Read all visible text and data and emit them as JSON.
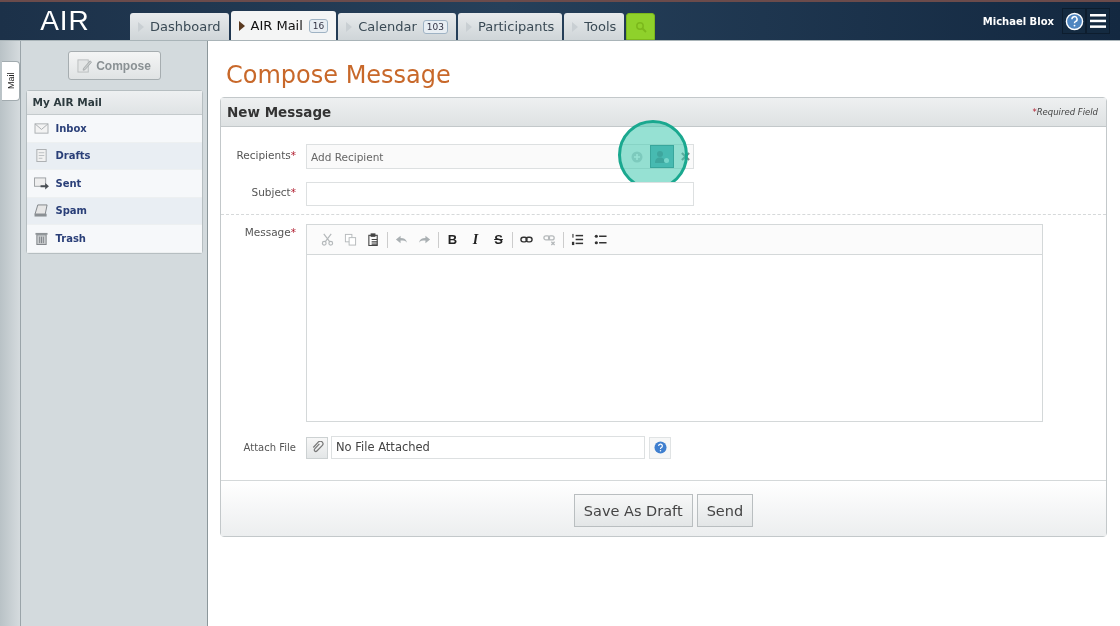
{
  "header": {
    "logo": "AIR",
    "user": "Michael Blox"
  },
  "tabs": [
    {
      "label": "Dashboard",
      "selected": false
    },
    {
      "label": "AIR Mail",
      "selected": true,
      "badge": "16"
    },
    {
      "label": "Calendar",
      "selected": false,
      "badge": "103"
    },
    {
      "label": "Participants",
      "selected": false
    },
    {
      "label": "Tools",
      "selected": false
    }
  ],
  "side_tab": {
    "label": "Mail"
  },
  "sidebar": {
    "compose": "Compose",
    "title": "My AIR Mail",
    "items": [
      {
        "label": "Inbox",
        "kind": "inbox",
        "selected": false
      },
      {
        "label": "Drafts",
        "kind": "drafts",
        "selected": false
      },
      {
        "label": "Sent",
        "kind": "sent",
        "selected": false
      },
      {
        "label": "Spam",
        "kind": "spam",
        "selected": false
      },
      {
        "label": "Trash",
        "kind": "trash",
        "selected": false
      }
    ]
  },
  "page_title": "Compose Message",
  "panel": {
    "title": "New Message",
    "required_note": {
      "mark": "*",
      "text": "Required Field"
    },
    "recipients": {
      "label": "Recipients",
      "mark": "*",
      "placeholder": "Add Recipient"
    },
    "subject": {
      "label": "Subject",
      "mark": "*"
    },
    "message": {
      "label": "Message",
      "mark": "*",
      "toolbar": [
        {
          "kind": "cut"
        },
        {
          "kind": "copy"
        },
        {
          "kind": "paste"
        },
        {
          "kind": "sep"
        },
        {
          "kind": "undo"
        },
        {
          "kind": "redo"
        },
        {
          "kind": "sep"
        },
        {
          "kind": "bold",
          "text": "B"
        },
        {
          "kind": "italic",
          "text": "I"
        },
        {
          "kind": "strike",
          "text": "S"
        },
        {
          "kind": "sep"
        },
        {
          "kind": "link"
        },
        {
          "kind": "unlink"
        },
        {
          "kind": "sep"
        },
        {
          "kind": "ol"
        },
        {
          "kind": "ul"
        }
      ]
    },
    "attach": {
      "label": "Attach File",
      "value": "No File Attached"
    },
    "buttons": [
      "Save As Draft",
      "Send"
    ]
  }
}
